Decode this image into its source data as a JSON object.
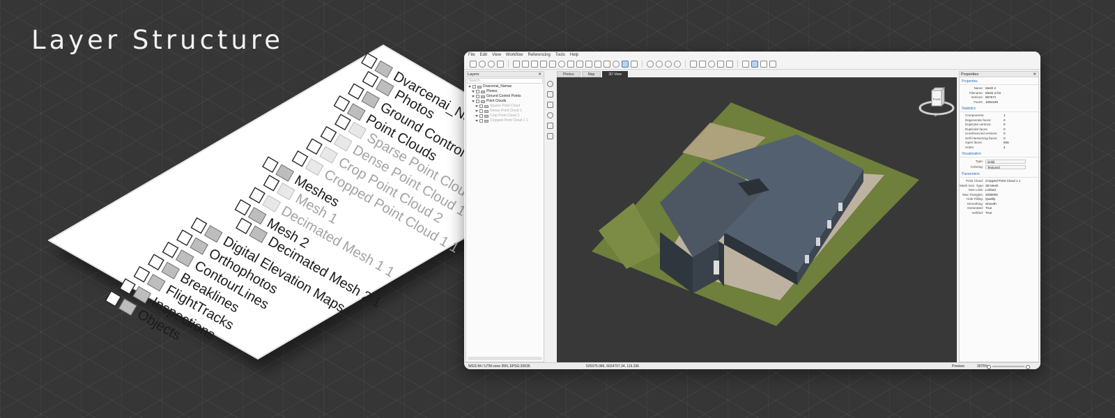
{
  "page": {
    "headline": "Layer Structure"
  },
  "iso_card": {
    "layers": [
      {
        "label": "Dvarcenai_Namas",
        "state": "on"
      },
      {
        "label": "Photos",
        "state": "on"
      },
      {
        "label": "Ground Control Points",
        "state": "on"
      },
      {
        "label": "Point Clouds",
        "state": "on"
      },
      {
        "label": "Sparse Point Cloud",
        "state": "off"
      },
      {
        "label": "Dense Point Cloud 1",
        "state": "off"
      },
      {
        "label": "Crop Point Cloud 2",
        "state": "off"
      },
      {
        "label": "Cropped Point Cloud 1 1",
        "state": "off"
      },
      {
        "label": "Meshes",
        "state": "on"
      },
      {
        "label": "Mesh 1",
        "state": "off"
      },
      {
        "label": "Decimated Mesh 1 1",
        "state": "off"
      },
      {
        "label": "Mesh 2",
        "state": "on"
      },
      {
        "label": "Decimated Mesh 2 1",
        "state": "on"
      },
      {
        "label": "Digital Elevation Maps",
        "state": "on"
      },
      {
        "label": "Orthophotos",
        "state": "on"
      },
      {
        "label": "ContourLines",
        "state": "on"
      },
      {
        "label": "Breaklines",
        "state": "on"
      },
      {
        "label": "FlightTracks",
        "state": "on"
      },
      {
        "label": "Inspections",
        "state": "on"
      },
      {
        "label": "Objects",
        "state": "on"
      }
    ]
  },
  "app": {
    "menu": [
      "File",
      "Edit",
      "View",
      "Workflow",
      "Referencing",
      "Tools",
      "Help"
    ],
    "layers_panel": {
      "title": "Layers",
      "search_placeholder": "Search",
      "tree": [
        {
          "label": "Dvarcenai_Namas",
          "state": "on"
        },
        {
          "label": "Photos",
          "state": "on"
        },
        {
          "label": "Ground Control Points",
          "state": "on"
        },
        {
          "label": "Point Clouds",
          "state": "on"
        },
        {
          "label": "Sparse Point Cloud",
          "state": "off"
        },
        {
          "label": "Dense Point Cloud 1",
          "state": "off"
        },
        {
          "label": "Crop Point Cloud 2",
          "state": "off"
        },
        {
          "label": "Cropped Point Cloud 1 1",
          "state": "off"
        }
      ]
    },
    "view_tabs": [
      "Photos",
      "Map",
      "3D View"
    ],
    "nav_cube": {
      "face": "Front",
      "south": "S",
      "east": "E"
    },
    "properties": {
      "title": "Properties",
      "sections": {
        "properties": "Properties",
        "statistics": "Statistics",
        "visualization": "Visualization",
        "parameters": "Parameters"
      },
      "basic": [
        {
          "k": "Name:",
          "v": "Mesh 2"
        },
        {
          "k": "Filename:",
          "v": "Mesh 3.fcs"
        },
        {
          "k": "Vertices:",
          "v": "567571"
        },
        {
          "k": "Faces:",
          "v": "1084109"
        }
      ],
      "stats": [
        {
          "k": "Components:",
          "v": "1"
        },
        {
          "k": "Degenerate faces:",
          "v": "0"
        },
        {
          "k": "Duplicate vertices:",
          "v": "0"
        },
        {
          "k": "Duplicate faces:",
          "v": "0"
        },
        {
          "k": "Unreferenced vertices:",
          "v": "0"
        },
        {
          "k": "Self intersecting faces:",
          "v": "0"
        },
        {
          "k": "Open faces:",
          "v": "836"
        },
        {
          "k": "Holes:",
          "v": "4"
        }
      ],
      "visual": [
        {
          "k": "Type:",
          "v": "Solid"
        },
        {
          "k": "Coloring:",
          "v": "Textured"
        }
      ],
      "params": [
        {
          "k": "Point Cloud:",
          "v": "Cropped Point Cloud 1 1"
        },
        {
          "k": "Mesh Gen. Type:",
          "v": "3D Mesh"
        },
        {
          "k": "Size Limit:",
          "v": "Limited"
        },
        {
          "k": "Max Triangles:",
          "v": "2000000"
        },
        {
          "k": "Hole Filling:",
          "v": "Quality"
        },
        {
          "k": "Smoothing:",
          "v": "Smooth"
        },
        {
          "k": "Generated:",
          "v": "True"
        },
        {
          "k": "Verified:",
          "v": "True"
        }
      ]
    },
    "status": {
      "crs": "WGS 84 / UTM zone 35N, EPSG:32635",
      "coords": "525975.086, 6024707.34, 116.336",
      "mode": "Preview",
      "zoom": "3075%"
    }
  },
  "colors": {
    "background": "#363636",
    "viewport": "#383838",
    "roof": "#4a5561",
    "grass": "#6d7f3a",
    "gravel": "#b9ad98",
    "accent": "#2f6db3"
  }
}
